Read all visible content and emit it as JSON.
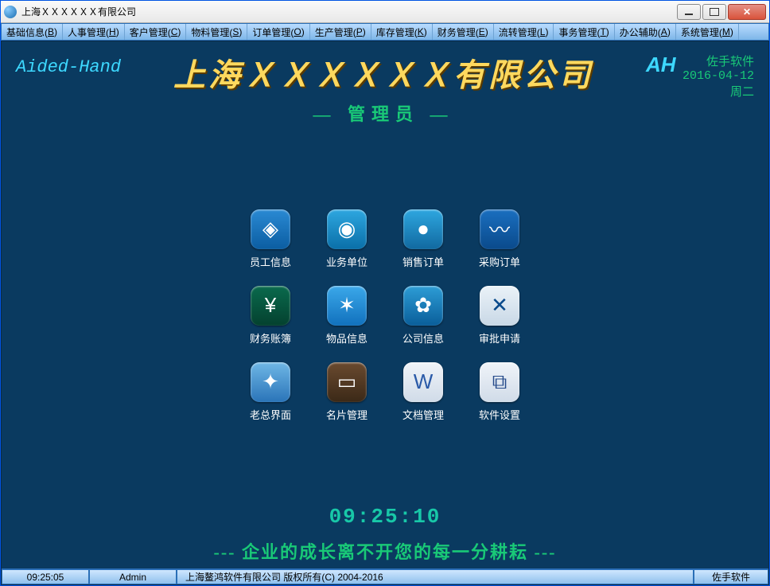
{
  "window": {
    "title": "上海ＸＸＸＸＸＸ有限公司"
  },
  "menu": [
    {
      "label": "基础信息",
      "hotkey": "B"
    },
    {
      "label": "人事管理",
      "hotkey": "H"
    },
    {
      "label": "客户管理",
      "hotkey": "C"
    },
    {
      "label": "物料管理",
      "hotkey": "S"
    },
    {
      "label": "订单管理",
      "hotkey": "O"
    },
    {
      "label": "生产管理",
      "hotkey": "P"
    },
    {
      "label": "库存管理",
      "hotkey": "K"
    },
    {
      "label": "财务管理",
      "hotkey": "E"
    },
    {
      "label": "流转管理",
      "hotkey": "L"
    },
    {
      "label": "事务管理",
      "hotkey": "T"
    },
    {
      "label": "办公辅助",
      "hotkey": "A"
    },
    {
      "label": "系统管理",
      "hotkey": "M"
    }
  ],
  "banner": {
    "left": "Aided-Hand",
    "company": "上海ＸＸＸＸＸＸ有限公司",
    "role": "— 管理员 —",
    "ah": "AH",
    "brand": "佐手软件",
    "date": "2016-04-12",
    "weekday": "周二"
  },
  "tiles": [
    {
      "name": "employee-info",
      "label": "员工信息",
      "icon": "◈",
      "cls": "ico-employee"
    },
    {
      "name": "business-unit",
      "label": "业务单位",
      "icon": "◉",
      "cls": "ico-business"
    },
    {
      "name": "sales-order",
      "label": "销售订单",
      "icon": "●",
      "cls": "ico-sales"
    },
    {
      "name": "purchase-order",
      "label": "采购订单",
      "icon": "〰",
      "cls": "ico-purchase"
    },
    {
      "name": "finance-ledger",
      "label": "财务账簿",
      "icon": "¥",
      "cls": "ico-finance"
    },
    {
      "name": "goods-info",
      "label": "物品信息",
      "icon": "✶",
      "cls": "ico-goods"
    },
    {
      "name": "company-info",
      "label": "公司信息",
      "icon": "✿",
      "cls": "ico-company"
    },
    {
      "name": "approval",
      "label": "审批申请",
      "icon": "✕",
      "cls": "ico-approve"
    },
    {
      "name": "boss-view",
      "label": "老总界面",
      "icon": "✦",
      "cls": "ico-boss"
    },
    {
      "name": "card-manage",
      "label": "名片管理",
      "icon": "▭",
      "cls": "ico-card"
    },
    {
      "name": "doc-manage",
      "label": "文档管理",
      "icon": "W",
      "cls": "ico-doc"
    },
    {
      "name": "software-setting",
      "label": "软件设置",
      "icon": "⧉",
      "cls": "ico-setting"
    }
  ],
  "clock": "09:25:10",
  "slogan": "---  企业的成长离不开您的每一分耕耘  ---",
  "status": {
    "time": "09:25:05",
    "user": "Admin",
    "copyright": "上海鳌鸿软件有限公司 版权所有(C) 2004-2016",
    "brand": "佐手软件"
  }
}
